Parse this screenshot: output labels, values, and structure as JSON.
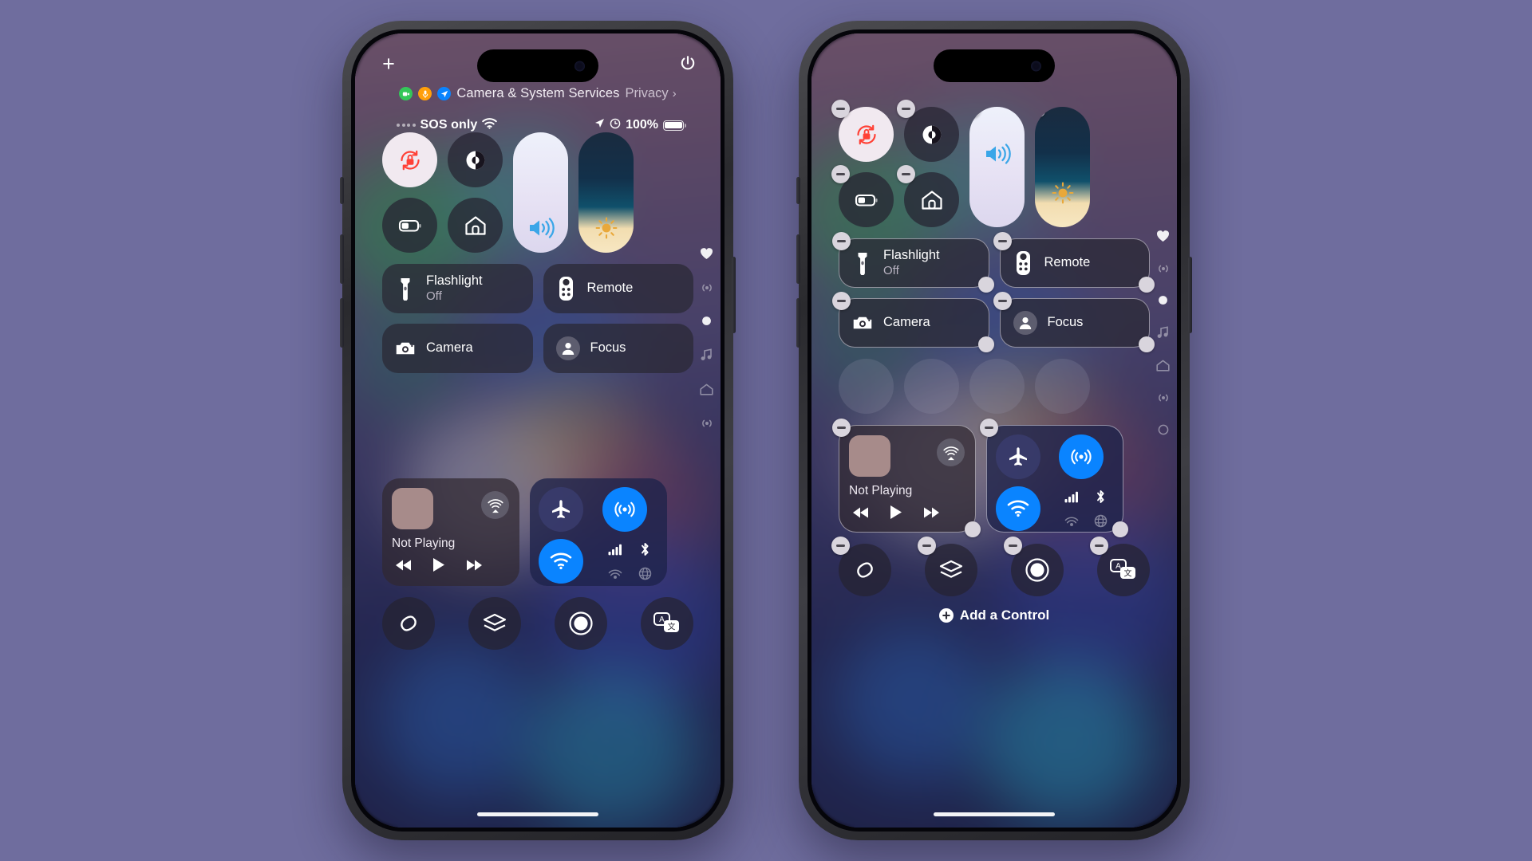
{
  "background_color": "#6f6d9e",
  "phones": [
    {
      "id": "left",
      "mode": "control-center",
      "header": {
        "add_button": "+",
        "power_button_name": "power-icon",
        "privacy": {
          "indicators": [
            "camera-indicator",
            "microphone-indicator",
            "location-indicator"
          ],
          "title": "Camera & System Services",
          "link": "Privacy",
          "chevron": "›"
        }
      },
      "status_bar": {
        "carrier": "SOS only",
        "wifi_icon": "wifi-icon",
        "location_icon": "location-arrow-icon",
        "alarm_icon": "alarm-icon",
        "battery_percent": "100%",
        "battery_icon": "battery-full-icon"
      },
      "controls": {
        "circles": [
          {
            "name": "rotation-lock",
            "icon": "rotation-lock-icon",
            "state": "on"
          },
          {
            "name": "dark-mode",
            "icon": "dark-mode-icon",
            "state": "off"
          },
          {
            "name": "low-power-mode",
            "icon": "battery-low-power-icon",
            "state": "off"
          },
          {
            "name": "home",
            "icon": "home-icon",
            "state": "off"
          }
        ],
        "sliders": [
          {
            "name": "volume-slider",
            "icon": "speaker-waves-icon",
            "level": 100
          },
          {
            "name": "brightness-slider",
            "icon": "sun-icon",
            "level": 22
          }
        ],
        "tiles": [
          {
            "name": "flashlight",
            "icon": "flashlight-icon",
            "title": "Flashlight",
            "subtitle": "Off"
          },
          {
            "name": "remote",
            "icon": "remote-icon",
            "title": "Remote",
            "subtitle": ""
          },
          {
            "name": "camera",
            "icon": "camera-icon",
            "title": "Camera",
            "subtitle": ""
          },
          {
            "name": "focus",
            "icon": "person-icon",
            "title": "Focus",
            "subtitle": ""
          }
        ],
        "media": {
          "name": "now-playing",
          "status": "Not Playing",
          "airplay_icon": "airplay-audio-icon",
          "transport": [
            "rewind-icon",
            "play-icon",
            "fast-forward-icon"
          ]
        },
        "connectivity": {
          "airplane_mode": {
            "icon": "airplane-icon",
            "active": false
          },
          "airdrop": {
            "icon": "airdrop-icon",
            "active": true
          },
          "wifi": {
            "icon": "wifi-icon",
            "active": true
          },
          "cellular": {
            "icon": "cellular-bars-icon",
            "active": false
          },
          "bluetooth": {
            "icon": "bluetooth-icon",
            "active": false
          },
          "hotspot": {
            "icon": "hotspot-icon",
            "active": false
          },
          "vpn": {
            "icon": "vpn-icon",
            "active": false
          }
        },
        "bottom_row": [
          {
            "name": "shazam",
            "icon": "shazam-icon"
          },
          {
            "name": "screen-mirroring",
            "icon": "layers-icon"
          },
          {
            "name": "screen-record",
            "icon": "record-icon"
          },
          {
            "name": "translate",
            "icon": "translate-icon"
          }
        ]
      },
      "rail": [
        {
          "name": "favorites-page",
          "icon": "heart-icon"
        },
        {
          "name": "connectivity-page",
          "icon": "signal-icon"
        },
        {
          "name": "now-playing-page",
          "icon": "dot-icon"
        },
        {
          "name": "music-page",
          "icon": "music-note-icon"
        },
        {
          "name": "home-page",
          "icon": "home-icon"
        },
        {
          "name": "connectivity-page-2",
          "icon": "signal-icon"
        }
      ]
    },
    {
      "id": "right",
      "mode": "edit",
      "header": {
        "privacy": {
          "indicators": [],
          "title": "",
          "link": "",
          "chevron": ""
        }
      },
      "status_bar": {
        "carrier": "",
        "battery_percent": ""
      },
      "controls": {
        "circles": [
          {
            "name": "rotation-lock",
            "icon": "rotation-lock-icon",
            "state": "on",
            "removable": true
          },
          {
            "name": "dark-mode",
            "icon": "dark-mode-icon",
            "state": "off",
            "removable": true
          },
          {
            "name": "low-power-mode",
            "icon": "battery-low-power-icon",
            "state": "off",
            "removable": true
          },
          {
            "name": "home",
            "icon": "home-icon",
            "state": "off",
            "removable": true
          }
        ],
        "sliders": [
          {
            "name": "volume-slider",
            "icon": "speaker-waves-icon",
            "level": 100,
            "removable": true
          },
          {
            "name": "brightness-slider",
            "icon": "sun-icon",
            "level": 30,
            "removable": true
          }
        ],
        "tiles": [
          {
            "name": "flashlight",
            "icon": "flashlight-icon",
            "title": "Flashlight",
            "subtitle": "Off",
            "removable": true,
            "resizable": true
          },
          {
            "name": "remote",
            "icon": "remote-icon",
            "title": "Remote",
            "subtitle": "",
            "removable": true,
            "resizable": true
          },
          {
            "name": "camera",
            "icon": "camera-icon",
            "title": "Camera",
            "subtitle": "",
            "removable": true,
            "resizable": true
          },
          {
            "name": "focus",
            "icon": "person-icon",
            "title": "Focus",
            "subtitle": "",
            "removable": true,
            "resizable": true
          }
        ],
        "empty_slots": 4,
        "media": {
          "name": "now-playing",
          "status": "Not Playing",
          "airplay_icon": "airplay-audio-icon",
          "transport": [
            "rewind-icon",
            "play-icon",
            "fast-forward-icon"
          ],
          "removable": true,
          "resizable": true
        },
        "connectivity": {
          "airplane_mode": {
            "icon": "airplane-icon",
            "active": false
          },
          "airdrop": {
            "icon": "airdrop-icon",
            "active": true
          },
          "wifi": {
            "icon": "wifi-icon",
            "active": true
          },
          "cellular": {
            "icon": "cellular-bars-icon",
            "active": false
          },
          "bluetooth": {
            "icon": "bluetooth-icon",
            "active": false
          },
          "hotspot": {
            "icon": "hotspot-icon",
            "active": false
          },
          "vpn": {
            "icon": "vpn-icon",
            "active": false
          },
          "removable": true,
          "resizable": true
        },
        "bottom_row": [
          {
            "name": "shazam",
            "icon": "shazam-icon",
            "removable": true
          },
          {
            "name": "screen-mirroring",
            "icon": "layers-icon",
            "removable": true
          },
          {
            "name": "screen-record",
            "icon": "record-icon",
            "removable": true
          },
          {
            "name": "translate",
            "icon": "translate-icon",
            "removable": true
          }
        ],
        "add_control": {
          "label": "Add a Control",
          "icon": "plus-circle-icon"
        }
      },
      "rail": [
        {
          "name": "favorites-page",
          "icon": "heart-icon"
        },
        {
          "name": "connectivity-page",
          "icon": "signal-icon"
        },
        {
          "name": "now-playing-page",
          "icon": "dot-icon"
        },
        {
          "name": "music-page",
          "icon": "music-note-icon"
        },
        {
          "name": "home-page",
          "icon": "home-icon"
        },
        {
          "name": "connectivity-page-2",
          "icon": "signal-icon"
        },
        {
          "name": "extra-page",
          "icon": "circle-outline-icon"
        }
      ]
    }
  ],
  "colors": {
    "accent_blue": "#0a84ff",
    "rotation_lock_red": "#ff3b30",
    "indicator_green": "#34c759",
    "indicator_orange": "#ff9f0a",
    "indicator_blue": "#0a84ff",
    "tile_bg": "rgba(42,40,52,.74)"
  }
}
